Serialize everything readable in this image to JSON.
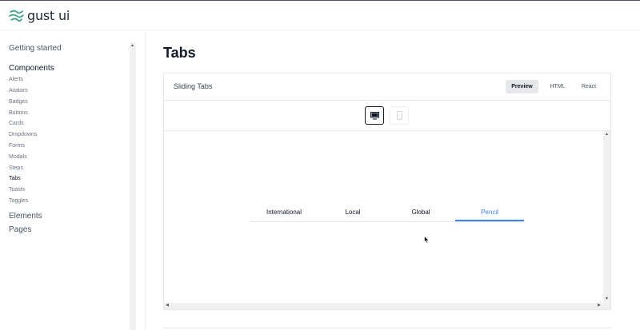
{
  "app": {
    "name": "gust ui"
  },
  "sidebar": {
    "getting_started": "Getting started",
    "components_heading": "Components",
    "components": [
      {
        "label": "Alerts"
      },
      {
        "label": "Avatars"
      },
      {
        "label": "Badges"
      },
      {
        "label": "Buttons"
      },
      {
        "label": "Cards"
      },
      {
        "label": "Dropdowns"
      },
      {
        "label": "Forms"
      },
      {
        "label": "Modals"
      },
      {
        "label": "Steps"
      },
      {
        "label": "Tabs",
        "active": true
      },
      {
        "label": "Toasts"
      },
      {
        "label": "Toggles"
      }
    ],
    "elements_heading": "Elements",
    "pages_heading": "Pages"
  },
  "page": {
    "title": "Tabs"
  },
  "example": {
    "title": "Sliding Tabs",
    "view_tabs": [
      {
        "label": "Preview",
        "active": true
      },
      {
        "label": "HTML"
      },
      {
        "label": "React"
      }
    ],
    "devices": [
      {
        "icon": "desktop-icon",
        "active": true
      },
      {
        "icon": "mobile-icon",
        "active": false
      }
    ],
    "demo_tabs": [
      {
        "label": "International"
      },
      {
        "label": "Local"
      },
      {
        "label": "Global"
      },
      {
        "label": "Pencil",
        "active": true
      }
    ]
  },
  "colors": {
    "accent": "#3b82f6",
    "logo": "#34a07a",
    "active_view_tab_bg": "#e5e7eb"
  }
}
